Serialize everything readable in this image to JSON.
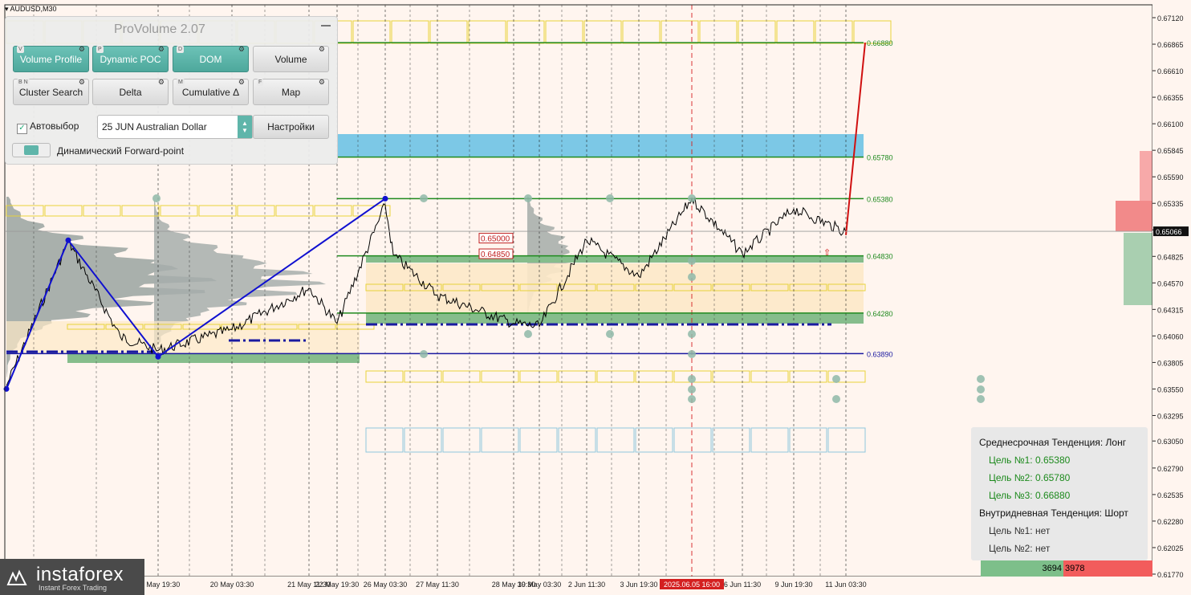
{
  "symbol": "AUDUSD,M30",
  "indicator_panel": {
    "title": "ProVolume 2.07",
    "buttons": [
      {
        "label": "Volume Profile",
        "key": "V",
        "active": true
      },
      {
        "label": "Dynamic POC",
        "key": "P",
        "active": true
      },
      {
        "label": "DOM",
        "key": "D",
        "active": true
      },
      {
        "label": "Volume",
        "key": "",
        "active": false
      },
      {
        "label": "Cluster Search",
        "key": "B  N",
        "active": false
      },
      {
        "label": "Delta",
        "key": "",
        "active": false
      },
      {
        "label": "Cumulative Δ",
        "key": "M",
        "active": false
      },
      {
        "label": "Map",
        "key": "F",
        "active": false
      }
    ],
    "auto_select_label": "Автовыбор",
    "auto_select_checked": true,
    "instrument_value": "25 JUN Australian Dollar",
    "settings_label": "Настройки",
    "forward_point_label": "Динамический Forward-point"
  },
  "chart_data": {
    "type": "line",
    "symbol": "AUDUSD",
    "timeframe": "M30",
    "ylim": [
      0.6167,
      0.6725
    ],
    "y_ticks": [
      "0.67120",
      "0.66865",
      "0.66610",
      "0.66355",
      "0.66100",
      "0.65845",
      "0.65590",
      "0.65335",
      "0.65080",
      "0.64825",
      "0.64570",
      "0.64315",
      "0.64060",
      "0.63805",
      "0.63550",
      "0.63295",
      "0.63050",
      "0.62790",
      "0.62535",
      "0.62280",
      "0.62025",
      "0.61770"
    ],
    "x_ticks": [
      "16 May 19:30",
      "20 May 03:30",
      "21 May 11:30",
      "22 May 19:30",
      "26 May 03:30",
      "27 May 11:30",
      "28 May 19:30",
      "30 May 03:30",
      "2 Jun 11:30",
      "3 Jun 19:30",
      "2025.06.05 16:00",
      "6 Jun 11:30",
      "9 Jun 19:30",
      "11 Jun 03:30"
    ],
    "current_price": "0.65066",
    "levels": [
      {
        "label": "0.66880",
        "value": 0.6688,
        "color": "#1f8a1f"
      },
      {
        "label": "0.65780",
        "value": 0.6578,
        "color": "#1f8a1f"
      },
      {
        "label": "0.65380",
        "value": 0.6538,
        "color": "#1f8a1f"
      },
      {
        "label": "0.64830",
        "value": 0.6483,
        "color": "#1f8a1f"
      },
      {
        "label": "0.64280",
        "value": 0.6428,
        "color": "#1f8a1f"
      },
      {
        "label": "0.63890",
        "value": 0.6389,
        "color": "#1a1aa0"
      }
    ],
    "boxed_prices": [
      {
        "label": "0.65000",
        "value": 0.65
      },
      {
        "label": "0.64850",
        "value": 0.6485
      }
    ],
    "zigzag": [
      {
        "x": "14 May 22:00",
        "y": 0.6355
      },
      {
        "x": "15 May 20:00",
        "y": 0.6498
      },
      {
        "x": "16 May 19:30",
        "y": 0.6386
      },
      {
        "x": "26 May 03:30",
        "y": 0.6538
      }
    ],
    "forecast": [
      {
        "x": "11 Jun 03:30",
        "y": 0.6503
      },
      {
        "x": "11 Jun 19:30",
        "y": 0.6688
      }
    ],
    "price_path": [
      {
        "x": "14 May 22:00",
        "y": 0.6358
      },
      {
        "x": "15 May 20:00",
        "y": 0.6497
      },
      {
        "x": "16 May 10:00",
        "y": 0.6405
      },
      {
        "x": "16 May 19:30",
        "y": 0.6392
      },
      {
        "x": "20 May 03:30",
        "y": 0.6412
      },
      {
        "x": "21 May 11:30",
        "y": 0.6452
      },
      {
        "x": "22 May 19:30",
        "y": 0.6418
      },
      {
        "x": "26 May 03:30",
        "y": 0.6532
      },
      {
        "x": "26 May 18:00",
        "y": 0.6484
      },
      {
        "x": "27 May 11:30",
        "y": 0.6445
      },
      {
        "x": "28 May 19:30",
        "y": 0.6418
      },
      {
        "x": "30 May 03:30",
        "y": 0.6415
      },
      {
        "x": "2 Jun 11:30",
        "y": 0.6498
      },
      {
        "x": "3 Jun 19:30",
        "y": 0.6463
      },
      {
        "x": "2025.06.05 16:00",
        "y": 0.6538
      },
      {
        "x": "6 Jun 11:30",
        "y": 0.6485
      },
      {
        "x": "9 Jun 19:30",
        "y": 0.6528
      },
      {
        "x": "11 Jun 03:30",
        "y": 0.6506
      }
    ]
  },
  "trend_panel": {
    "mid_term": "Среднесрочная Тенденция: Лонг",
    "mid_targets": [
      "Цель №1: 0.65380",
      "Цель №2: 0.65780",
      "Цель №3: 0.66880"
    ],
    "intraday": "Внутридневная Тенденция: Шорт",
    "intraday_targets": [
      "Цель №1: нет",
      "Цель №2: нет"
    ]
  },
  "volumes": {
    "buy": "3694",
    "sell": "3978"
  },
  "logo": {
    "name": "instaforex",
    "tagline": "Instant Forex Trading"
  },
  "colors": {
    "background": "#fff5ef",
    "price": "#000000",
    "zigzag": "#1010d0",
    "forecast": "#d01010",
    "level": "#1f8a1f"
  }
}
